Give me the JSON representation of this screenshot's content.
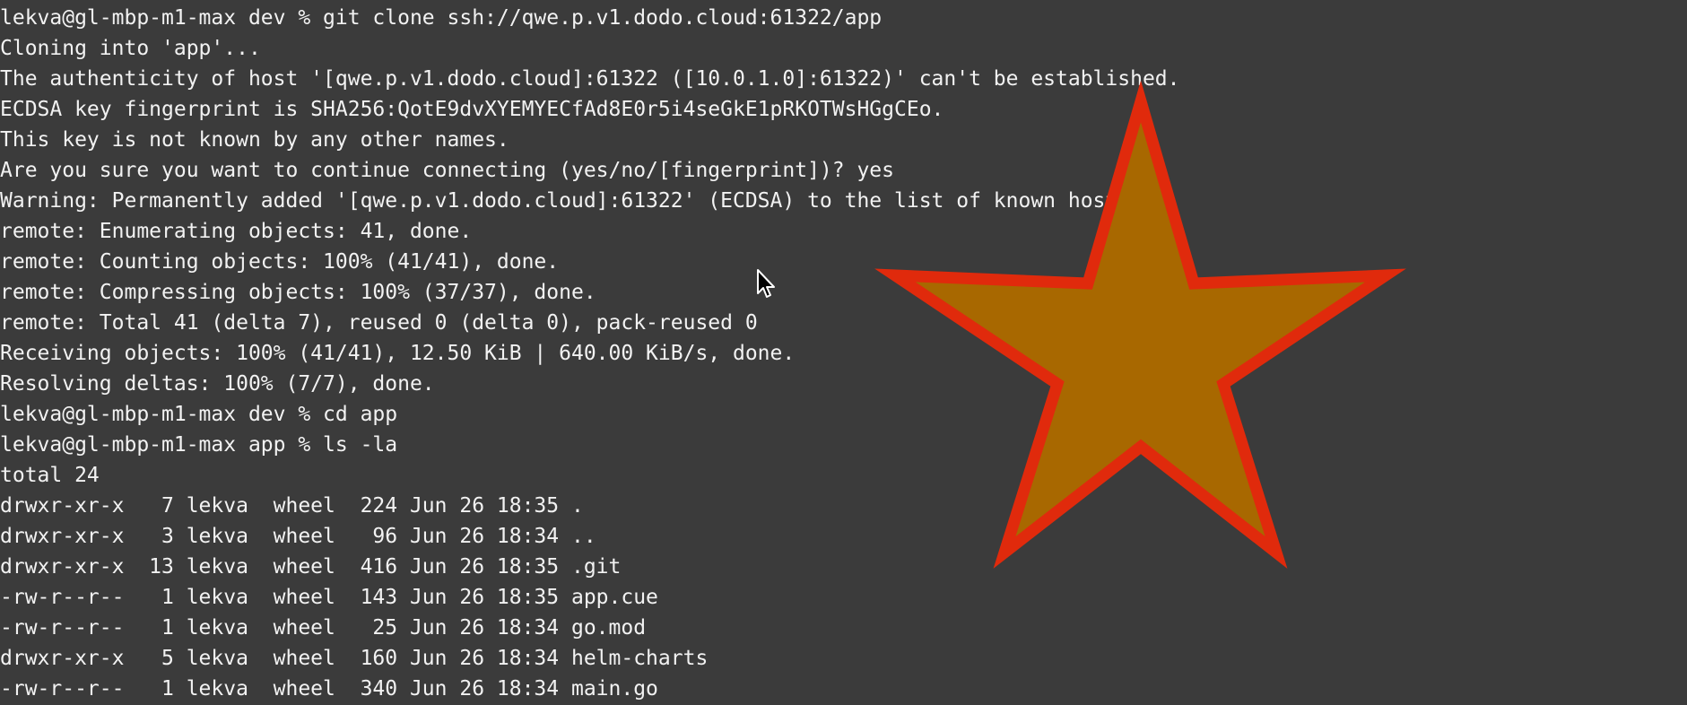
{
  "terminal": {
    "lines": [
      "lekva@gl-mbp-m1-max dev % git clone ssh://qwe.p.v1.dodo.cloud:61322/app",
      "Cloning into 'app'...",
      "The authenticity of host '[qwe.p.v1.dodo.cloud]:61322 ([10.0.1.0]:61322)' can't be established.",
      "ECDSA key fingerprint is SHA256:QotE9dvXYEMYECfAd8E0r5i4seGkE1pRKOTWsHGgCEo.",
      "This key is not known by any other names.",
      "Are you sure you want to continue connecting (yes/no/[fingerprint])? yes",
      "Warning: Permanently added '[qwe.p.v1.dodo.cloud]:61322' (ECDSA) to the list of known hosts.",
      "remote: Enumerating objects: 41, done.",
      "remote: Counting objects: 100% (41/41), done.",
      "remote: Compressing objects: 100% (37/37), done.",
      "remote: Total 41 (delta 7), reused 0 (delta 0), pack-reused 0",
      "Receiving objects: 100% (41/41), 12.50 KiB | 640.00 KiB/s, done.",
      "Resolving deltas: 100% (7/7), done.",
      "lekva@gl-mbp-m1-max dev % cd app",
      "lekva@gl-mbp-m1-max app % ls -la",
      "total 24",
      "drwxr-xr-x   7 lekva  wheel  224 Jun 26 18:35 .",
      "drwxr-xr-x   3 lekva  wheel   96 Jun 26 18:34 ..",
      "drwxr-xr-x  13 lekva  wheel  416 Jun 26 18:35 .git",
      "-rw-r--r--   1 lekva  wheel  143 Jun 26 18:35 app.cue",
      "-rw-r--r--   1 lekva  wheel   25 Jun 26 18:34 go.mod",
      "drwxr-xr-x   5 lekva  wheel  160 Jun 26 18:34 helm-charts",
      "-rw-r--r--   1 lekva  wheel  340 Jun 26 18:34 main.go"
    ]
  },
  "colors": {
    "background": "#3b3b3b",
    "text": "#f2f2f2",
    "star_fill": "#a86800",
    "star_stroke": "#e02a0c",
    "cursor_fill": "#000000",
    "cursor_stroke": "#ffffff"
  },
  "icons": {
    "overlay_shape": "star-icon",
    "pointer": "mouse-cursor-icon"
  }
}
